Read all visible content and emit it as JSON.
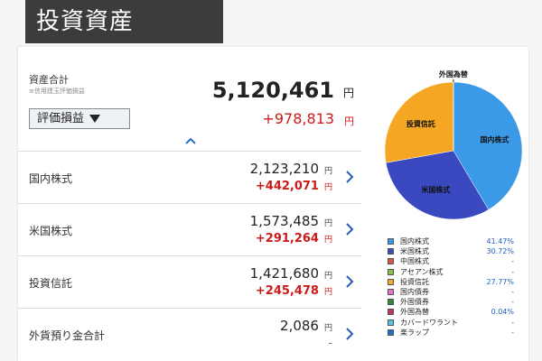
{
  "header": {
    "title": "投資資産"
  },
  "summary": {
    "total_label": "資産合計",
    "total_sub": "≡信用建玉評価損益",
    "total_value": "5,120,461",
    "yen": "円",
    "eval_button": "評価損益",
    "total_gain": "+978,813"
  },
  "rows": [
    {
      "name": "国内株式",
      "value": "2,123,210",
      "gain": "+442,071"
    },
    {
      "name": "米国株式",
      "value": "1,573,485",
      "gain": "+291,264"
    },
    {
      "name": "投資信託",
      "value": "1,421,680",
      "gain": "+245,478"
    },
    {
      "name": "外貨預り金合計",
      "value": "2,086",
      "gain": "-"
    }
  ],
  "colors": {
    "domestic": "#3b9ae8",
    "us": "#3a49bf",
    "fund": "#f5a623",
    "fx": "#1a7a7a",
    "gain": "#cc1a1a"
  },
  "chart_data": {
    "type": "pie",
    "slices": [
      {
        "name": "国内株式",
        "value": 41.47,
        "color": "#3b9ae8"
      },
      {
        "name": "米国株式",
        "value": 30.72,
        "color": "#3a49bf"
      },
      {
        "name": "投資信託",
        "value": 27.77,
        "color": "#f5a623"
      },
      {
        "name": "外国為替",
        "value": 0.04,
        "color": "#1a7a7a"
      }
    ],
    "slice_labels": [
      "国内株式",
      "米国株式",
      "投資信託",
      "外国為替"
    ]
  },
  "legend": [
    {
      "label": "国内株式",
      "pct": "41.47%",
      "color": "#3b9ae8"
    },
    {
      "label": "米国株式",
      "pct": "30.72%",
      "color": "#3a49bf"
    },
    {
      "label": "中国株式",
      "pct": "-",
      "color": "#d9534f"
    },
    {
      "label": "アセアン株式",
      "pct": "-",
      "color": "#8bc34a"
    },
    {
      "label": "投資信託",
      "pct": "27.77%",
      "color": "#f5a623"
    },
    {
      "label": "国内債券",
      "pct": "-",
      "color": "#e66fd0"
    },
    {
      "label": "外国債券",
      "pct": "-",
      "color": "#2e8b3a"
    },
    {
      "label": "外国為替",
      "pct": "0.04%",
      "color": "#c03070"
    },
    {
      "label": "カバードワラント",
      "pct": "-",
      "color": "#56c2e6"
    },
    {
      "label": "楽ラップ",
      "pct": "-",
      "color": "#1f6fd0"
    }
  ]
}
